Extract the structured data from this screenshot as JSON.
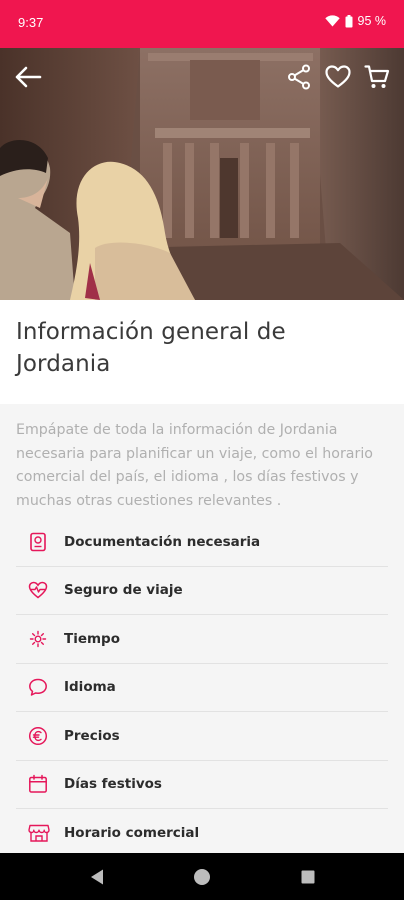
{
  "status_bar": {
    "time": "9:37",
    "battery": "95 %",
    "icons": [
      "wifi-icon",
      "battery-icon"
    ]
  },
  "header": {
    "icons": [
      "back-arrow-icon",
      "share-icon",
      "heart-icon",
      "cart-icon"
    ],
    "icon_color": "#ffffff"
  },
  "page": {
    "title": "Información general de Jordania",
    "intro": "Empápate de toda la información de Jordania necesaria para planificar un viaje, como el horario comercial  del país, el  idioma , los  días festivos  y muchas otras cuestiones relevantes ."
  },
  "menu": {
    "accent_color": "#e5175a",
    "items": [
      {
        "label": "Documentación necesaria",
        "icon": "passport-icon"
      },
      {
        "label": "Seguro de viaje",
        "icon": "heartbeat-icon"
      },
      {
        "label": "Tiempo",
        "icon": "sun-icon"
      },
      {
        "label": "Idioma",
        "icon": "speech-bubble-icon"
      },
      {
        "label": "Precios",
        "icon": "euro-icon"
      },
      {
        "label": "Días festivos",
        "icon": "calendar-icon"
      },
      {
        "label": "Horario comercial",
        "icon": "store-icon"
      }
    ]
  },
  "colors": {
    "status_bar": "#f0164f",
    "accent": "#e5175a",
    "title_text": "#3a3a3a",
    "intro_text": "#b0b0b0"
  },
  "nav_bar": {
    "icons": [
      "back-triangle-icon",
      "home-circle-icon",
      "recents-square-icon"
    ]
  }
}
